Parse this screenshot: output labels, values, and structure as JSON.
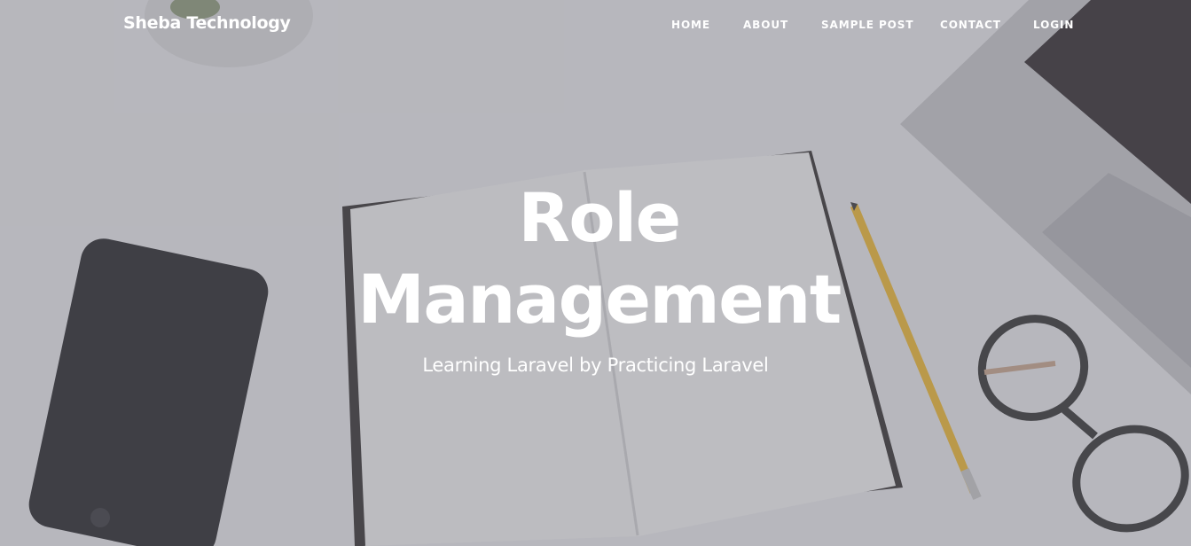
{
  "navbar": {
    "brand": "Sheba Technology",
    "links": {
      "home": "HOME",
      "about": "ABOUT",
      "sample_post": "SAMPLE POST",
      "contact": "CONTACT",
      "login": "LOGIN"
    }
  },
  "hero": {
    "title": "Role Management",
    "subtitle": "Learning Laravel by Practicing Laravel"
  },
  "colors": {
    "overlay": "#6e6e76",
    "text": "#ffffff",
    "desk": "#e9e9ec"
  }
}
